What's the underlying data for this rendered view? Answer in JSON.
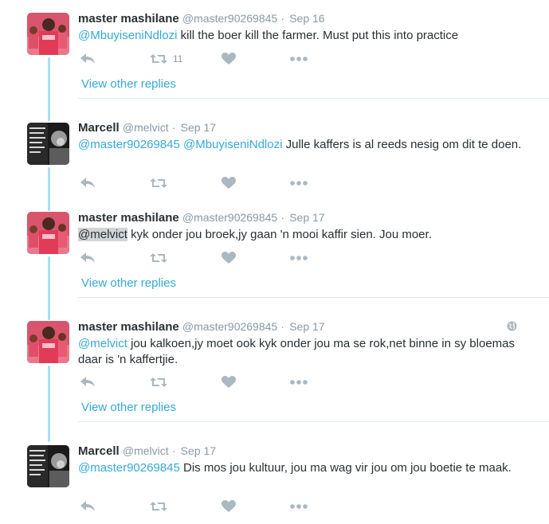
{
  "tweets": [
    {
      "name": "master mashilane",
      "handle": "@master90269845",
      "dot": "·",
      "time": "Sep 16",
      "mention1": "@MbuyiseniNdlozi",
      "text": "  kill the boer kill the farmer. Must put this into practice",
      "retweet_count": "11",
      "avatar": "red-crowd-photo"
    },
    {
      "name": "Marcell",
      "handle": "@melvict",
      "dot": "·",
      "time": "Sep 17",
      "mention1": "@master90269845",
      "mention2": "@MbuyiseniNdlozi",
      "text": " Julle kaffers is al reeds nesig om dit te doen.",
      "avatar": "bw-quote-photo"
    },
    {
      "name": "master mashilane",
      "handle": "@master90269845",
      "dot": "·",
      "time": "Sep 17",
      "mention1": "@melvict",
      "text": " kyk onder jou broek,jy gaan 'n mooi kaffir sien. Jou moer.",
      "avatar": "red-crowd-photo"
    },
    {
      "name": "master mashilane",
      "handle": "@master90269845",
      "dot": "·",
      "time": "Sep 17",
      "mention1": "@melvict",
      "text": "  jou kalkoen,jy moet ook kyk onder jou ma se rok,net binne in sy bloemas daar is 'n kaffertjie.",
      "avatar": "red-crowd-photo",
      "extra_icon": "globe-icon"
    },
    {
      "name": "Marcell",
      "handle": "@melvict",
      "dot": "·",
      "time": "Sep 17",
      "mention1": "@master90269845",
      "text": " Dis mos jou kultuur, jou ma wag vir jou om jou boetie te maak.",
      "avatar": "bw-quote-photo"
    }
  ],
  "view_other_replies": "View other replies",
  "avatar_quote_text": "\"An appeaser is one who feeds a crocodile, hoping it will eat him last.\"",
  "colors": {
    "link": "#35a9d7",
    "muted": "#8899a6",
    "icon": "#aab8c2",
    "thread_line": "#a6dff4",
    "highlight": "#d2d4d6"
  }
}
